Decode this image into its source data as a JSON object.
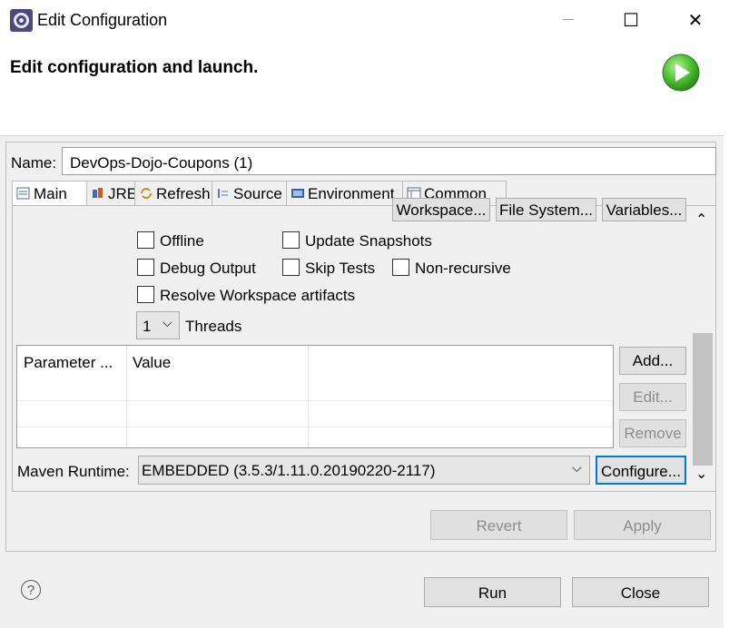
{
  "window": {
    "title": "Edit Configuration",
    "close_glyph": "✕",
    "maximize_glyph": "☐"
  },
  "header": {
    "title": "Edit configuration and launch."
  },
  "name": {
    "label": "Name:",
    "value": "DevOps-Dojo-Coupons (1)"
  },
  "tabs": [
    {
      "label": "Main",
      "icon": "main-tab-icon"
    },
    {
      "label": "JRE",
      "icon": "jre-icon"
    },
    {
      "label": "Refresh",
      "icon": "refresh-icon"
    },
    {
      "label": "Source",
      "icon": "source-icon"
    },
    {
      "label": "Environment",
      "icon": "environment-icon"
    },
    {
      "label": "Common",
      "icon": "common-icon"
    }
  ],
  "top_buttons": {
    "workspace": "Workspace...",
    "file_system": "File System...",
    "variables": "Variables..."
  },
  "options": {
    "offline": "Offline",
    "update_snapshots": "Update Snapshots",
    "debug_output": "Debug Output",
    "skip_tests": "Skip Tests",
    "non_recursive": "Non-recursive",
    "resolve_workspace": "Resolve Workspace artifacts"
  },
  "threads": {
    "value": "1",
    "label": "Threads"
  },
  "parameters": {
    "columns": [
      "Parameter ...",
      "Value"
    ],
    "add": "Add...",
    "edit": "Edit...",
    "remove": "Remove"
  },
  "maven_runtime": {
    "label": "Maven Runtime:",
    "value": "EMBEDDED (3.5.3/1.11.0.20190220-2117)",
    "configure": "Configure..."
  },
  "footer": {
    "revert": "Revert",
    "apply": "Apply",
    "run": "Run",
    "close": "Close",
    "help_glyph": "?"
  },
  "scroll": {
    "up_glyph": "⌃",
    "down_glyph": "⌄"
  },
  "colors": {
    "run_green": "#3fae2a",
    "accent_blue": "#0078d7"
  }
}
